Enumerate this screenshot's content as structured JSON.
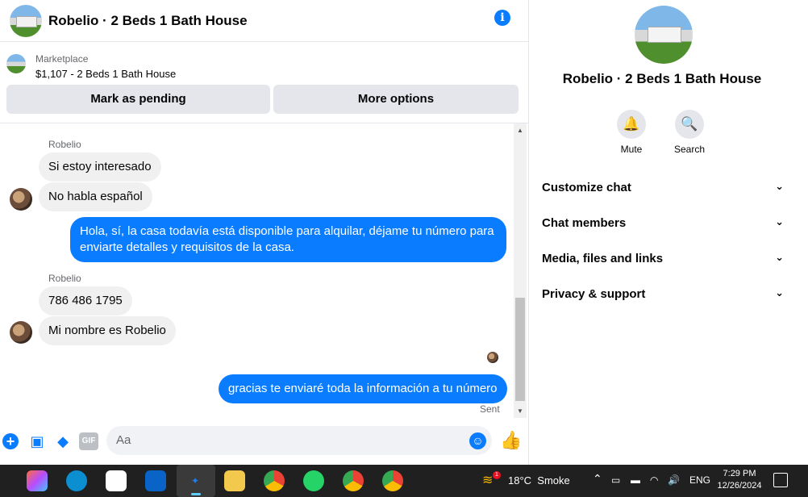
{
  "header": {
    "title": "Robelio · 2 Beds 1 Bath House",
    "info_icon": "info-icon"
  },
  "marketplace": {
    "label": "Marketplace",
    "listing": "$1,107 - 2 Beds 1 Bath House",
    "mark_pending": "Mark as pending",
    "more_options": "More options"
  },
  "messages": {
    "sender1": "Robelio",
    "m1": "Si estoy interesado",
    "m2": "No habla español",
    "m3": "Hola, sí, la casa todavía está disponible para alquilar, déjame tu número para enviarte detalles y requisitos de la casa.",
    "sender2": "Robelio",
    "m4": "786 486 1795",
    "m5": "Mi nombre es Robelio",
    "m6": "gracias te enviaré toda la información a tu número",
    "status": "Sent"
  },
  "composer": {
    "placeholder": "Aa"
  },
  "panel": {
    "title": "Robelio · 2 Beds 1 Bath House",
    "mute": "Mute",
    "search": "Search",
    "sections": [
      "Customize chat",
      "Chat members",
      "Media, files and links",
      "Privacy & support"
    ]
  },
  "taskbar": {
    "temperature": "18°C",
    "weather": "Smoke",
    "badge": "1",
    "language": "ENG",
    "time": "7:29 PM",
    "date": "12/26/2024"
  },
  "colors": {
    "accent": "#0a7cff",
    "incoming_bubble": "#f0f0f0",
    "taskbar": "#202020"
  }
}
